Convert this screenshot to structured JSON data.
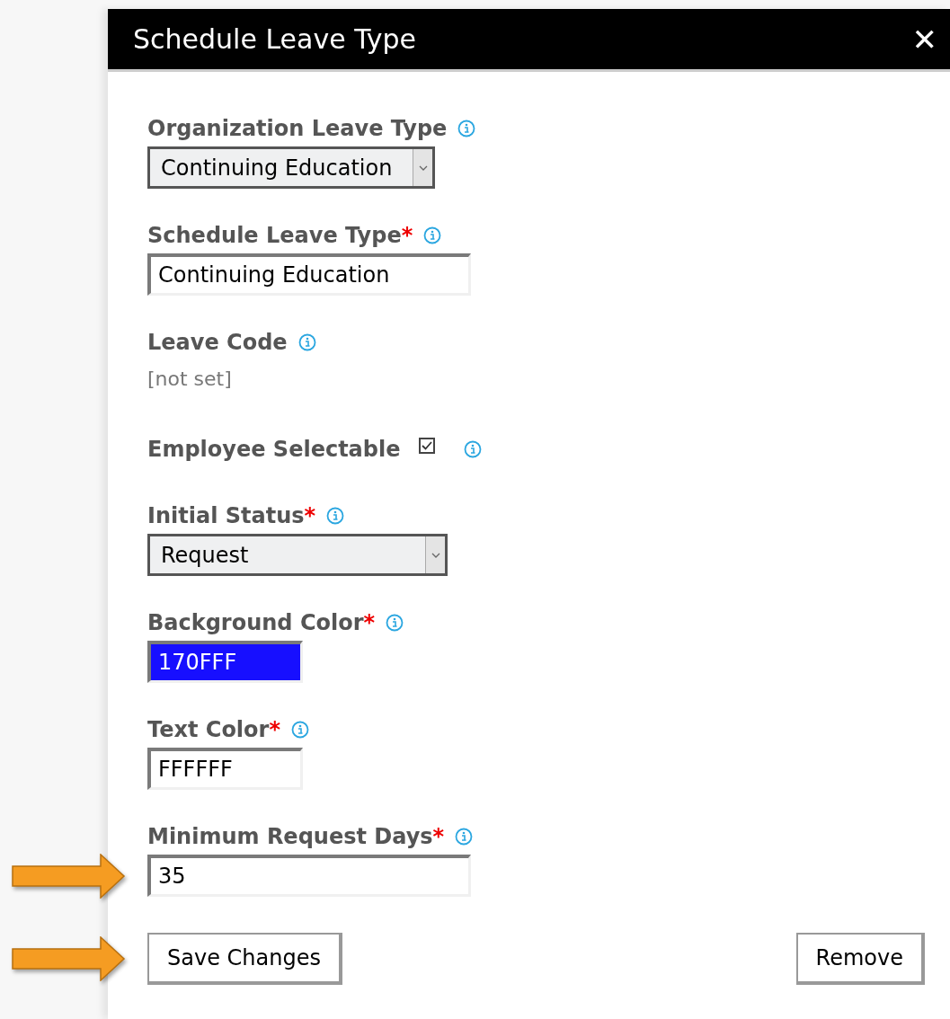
{
  "dialog": {
    "title": "Schedule Leave Type",
    "close": "✕"
  },
  "required_mark": "*",
  "fields": [
    {
      "kind": "select",
      "label": "Organization Leave Type",
      "required": false,
      "value": "Continuing Education"
    },
    {
      "kind": "text",
      "label": "Schedule Leave Type",
      "required": true,
      "value": "Continuing Education"
    },
    {
      "kind": "static",
      "label": "Leave Code",
      "required": false,
      "value": "[not set]"
    },
    {
      "kind": "checkbox",
      "label": "Employee Selectable",
      "required": false,
      "checked": true
    },
    {
      "kind": "select",
      "label": "Initial Status",
      "required": true,
      "value": "Request"
    },
    {
      "kind": "swatch",
      "label": "Background Color",
      "required": true,
      "value": "170FFF"
    },
    {
      "kind": "text",
      "label": "Text Color",
      "required": true,
      "value": "FFFFFF"
    },
    {
      "kind": "text",
      "label": "Minimum Request Days",
      "required": true,
      "value": "35",
      "pointed": true
    }
  ],
  "buttons": [
    {
      "label": "Save Changes",
      "pointed": true
    },
    {
      "label": "Remove",
      "pointed": false
    }
  ]
}
